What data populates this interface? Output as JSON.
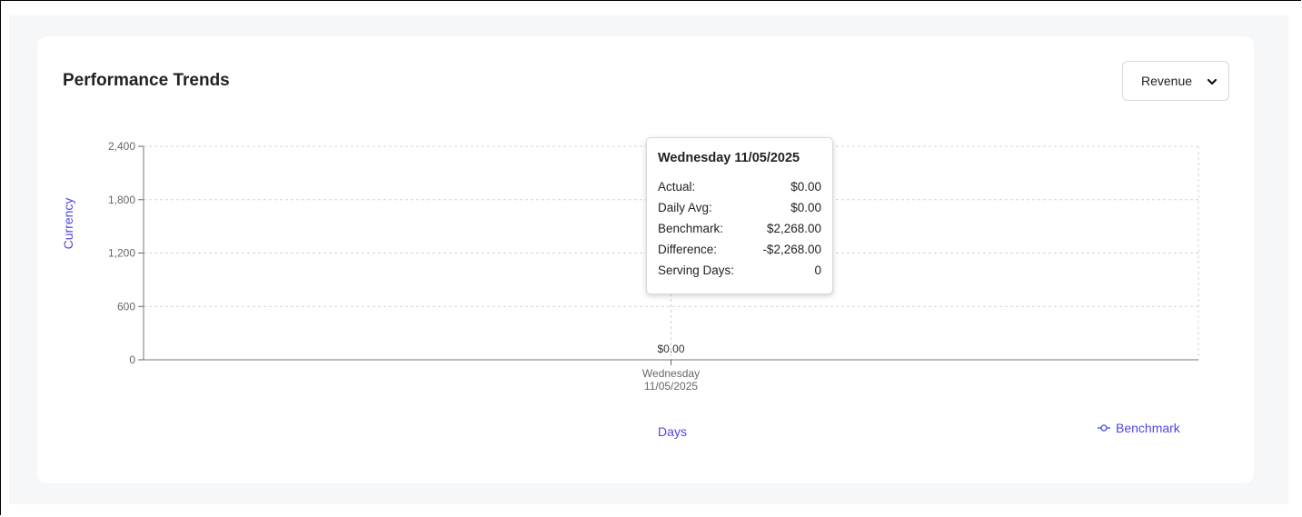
{
  "card": {
    "title": "Performance Trends",
    "metric_select": {
      "value": "Revenue"
    }
  },
  "chart_data": {
    "type": "line",
    "xlabel": "Days",
    "ylabel": "Currency",
    "ylim": [
      0,
      2400
    ],
    "yticks": [
      0,
      600,
      1200,
      1800,
      2400
    ],
    "ytick_labels": [
      "0",
      "600",
      "1,200",
      "1,800",
      "2,400"
    ],
    "categories": [
      "Wednesday 11/05/2025"
    ],
    "category_lines": [
      [
        "Wednesday",
        "11/05/2025"
      ]
    ],
    "series": [
      {
        "name": "Actual",
        "values": [
          0
        ],
        "data_labels": [
          "$0.00"
        ]
      },
      {
        "name": "Benchmark",
        "values": [
          2268
        ]
      }
    ],
    "grid": true,
    "legend": {
      "position": "bottom-right",
      "entries": [
        "Benchmark"
      ]
    },
    "colors": {
      "benchmark": "#6366f1",
      "axis_title": "#4f46e5",
      "grid": "#d4d4d4"
    }
  },
  "tooltip": {
    "title": "Wednesday 11/05/2025",
    "rows": [
      {
        "label": "Actual:",
        "value": "$0.00"
      },
      {
        "label": "Daily Avg:",
        "value": "$0.00"
      },
      {
        "label": "Benchmark:",
        "value": "$2,268.00"
      },
      {
        "label": "Difference:",
        "value": "-$2,268.00"
      },
      {
        "label": "Serving Days:",
        "value": "0"
      }
    ]
  }
}
